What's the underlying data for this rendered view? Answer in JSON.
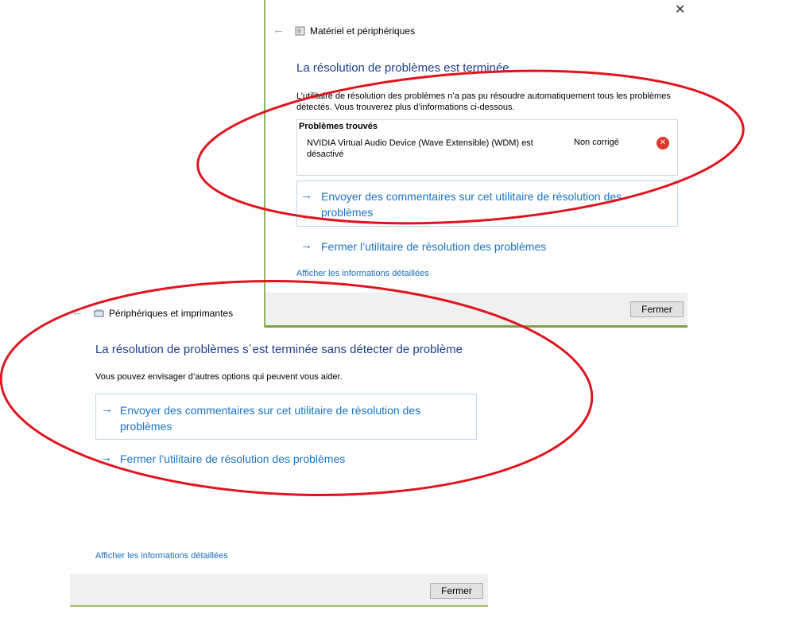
{
  "top_window": {
    "breadcrumb": "Matériel et périphériques",
    "title": "La résolution de problèmes est terminée",
    "description": "L’utilitaire de résolution des problèmes n’a pas pu résoudre automatiquement tous les problèmes détectés. Vous trouverez plus d’informations ci-dessous.",
    "problems_header": "Problèmes trouvés",
    "problem_item": "NVIDIA Virtual Audio Device (Wave Extensible) (WDM) est désactivé",
    "problem_status": "Non corrigé",
    "action_feedback": "Envoyer des commentaires sur cet utilitaire de résolution des problèmes",
    "action_close": "Fermer l’utilitaire de résolution des problèmes",
    "details_link": "Afficher les informations détaillées",
    "close_button": "Fermer"
  },
  "bottom_window": {
    "breadcrumb": "Périphériques et imprimantes",
    "title": "La résolution de problèmes s´est terminée sans détecter de problème",
    "description": "Vous pouvez envisager d’autres options qui peuvent vous aider.",
    "action_feedback": "Envoyer des commentaires sur cet utilitaire de résolution des problèmes",
    "action_close": "Fermer l’utilitaire de résolution des problèmes",
    "details_link": "Afficher les informations détaillées",
    "close_button": "Fermer"
  },
  "glyphs": {
    "close_window": "✕",
    "back": "←",
    "arrow": "→",
    "error": "✕"
  },
  "colors": {
    "title": "#1e3f8a",
    "link": "#1a73c4",
    "annotation": "#e0141e",
    "error_icon": "#e0352b"
  }
}
